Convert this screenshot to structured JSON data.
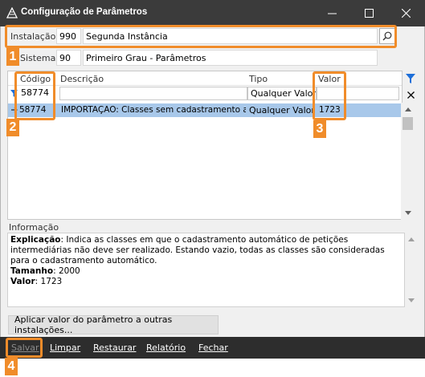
{
  "window": {
    "title": "Configuração de Parâmetros",
    "controls": {
      "minimize_icon": "minimize-icon",
      "maximize_icon": "maximize-icon",
      "close_icon": "close-icon"
    }
  },
  "header": {
    "instalacao_label": "Instalação",
    "instalacao_code": "990",
    "instalacao_name": "Segunda Instância",
    "sistema_label": "Sistema",
    "sistema_code": "90",
    "sistema_name": "Primeiro Grau - Parâmetros"
  },
  "grid": {
    "columns": {
      "codigo": "Código",
      "descricao": "Descrição",
      "tipo": "Tipo",
      "valor": "Valor"
    },
    "filters": {
      "codigo": "58774",
      "descricao": "",
      "tipo": "Qualquer Valor",
      "valor": ""
    },
    "rows": [
      {
        "codigo": "58774",
        "descricao": "IMPORTAÇÃO: Classes sem cadastramento aut",
        "tipo": "Qualquer Valor",
        "valor": "1723"
      }
    ]
  },
  "info": {
    "label": "Informação",
    "explicacao_label": "Explicação",
    "explicacao_text": ": Indica as classes em que o cadastramento automático de petições intermediárias não deve ser realizado. Estando vazio, todas as classes são consideradas para o cadastramento automático.",
    "tamanho_label": "Tamanho",
    "tamanho_value": ": 2000",
    "valor_label": "Valor",
    "valor_value": ": 1723"
  },
  "apply_button": "Aplicar valor do parâmetro a outras instalações...",
  "footer": {
    "salvar": "Salvar",
    "limpar": "Limpar",
    "restaurar": "Restaurar",
    "relatorio": "Relatório",
    "fechar": "Fechar"
  },
  "annotations": {
    "badge1": "1",
    "badge2": "2",
    "badge3": "3",
    "badge4": "4",
    "color": "#f08c2a"
  },
  "colors": {
    "titlebar": "#3b3b3b",
    "footer": "#2d2d2d",
    "selected_row": "#a8c8ea",
    "filter_icon": "#1e6fd9"
  }
}
